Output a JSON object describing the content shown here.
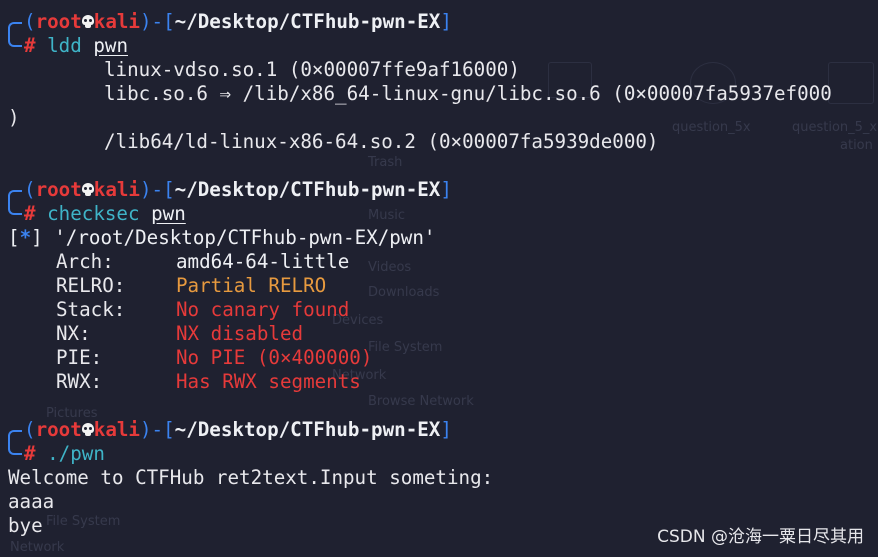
{
  "prompt": {
    "open_paren": "(",
    "user": "root",
    "host": "kali",
    "mid": ")-[",
    "path": "~/Desktop/CTFhub-pwn-EX",
    "close": "]",
    "hash": "#"
  },
  "block1": {
    "command": "ldd",
    "arg": "pwn",
    "lines": [
      "linux-vdso.so.1 (0×00007ffe9af16000)",
      "libc.so.6 ⇒ /lib/x86_64-linux-gnu/libc.so.6 (0×00007fa5937ef000",
      ")",
      "/lib64/ld-linux-x86-64.so.2 (0×00007fa5939de000)"
    ]
  },
  "block2": {
    "command": "checksec",
    "arg": "pwn",
    "info_open": "[",
    "info_star": "*",
    "info_close": "]",
    "info_path": " '/root/Desktop/CTFhub-pwn-EX/pwn'",
    "props": [
      {
        "key": "Arch:",
        "value": "amd64-64-little",
        "color": "#eef0f4"
      },
      {
        "key": "RELRO:",
        "value": "Partial RELRO",
        "color": "#e79a3f"
      },
      {
        "key": "Stack:",
        "value": "No canary found",
        "color": "#e63a3a"
      },
      {
        "key": "NX:",
        "value": "NX disabled",
        "color": "#e63a3a"
      },
      {
        "key": "PIE:",
        "value": "No PIE (0×400000)",
        "color": "#e63a3a"
      },
      {
        "key": "RWX:",
        "value": "Has RWX segments",
        "color": "#e63a3a"
      }
    ]
  },
  "block3": {
    "command": "./pwn",
    "output": [
      "Welcome to CTFHub ret2text.Input someting:",
      "aaaa",
      "bye"
    ]
  },
  "watermark": "CSDN @沧海一粟日尽其用",
  "background_ghosts": [
    "question_5x",
    "question_5_x",
    "ation",
    "Trash",
    "Music",
    "Videos",
    "Downloads",
    "Devices",
    "File System",
    "Network",
    "Browse Network",
    "Pictures",
    "File System",
    "Network"
  ],
  "colors": {
    "background": "#1f2130",
    "prompt_blue": "#3b83f0",
    "prompt_red": "#e63a3a",
    "command_cyan": "#3fb4c8",
    "relro_orange": "#e79a3f"
  }
}
